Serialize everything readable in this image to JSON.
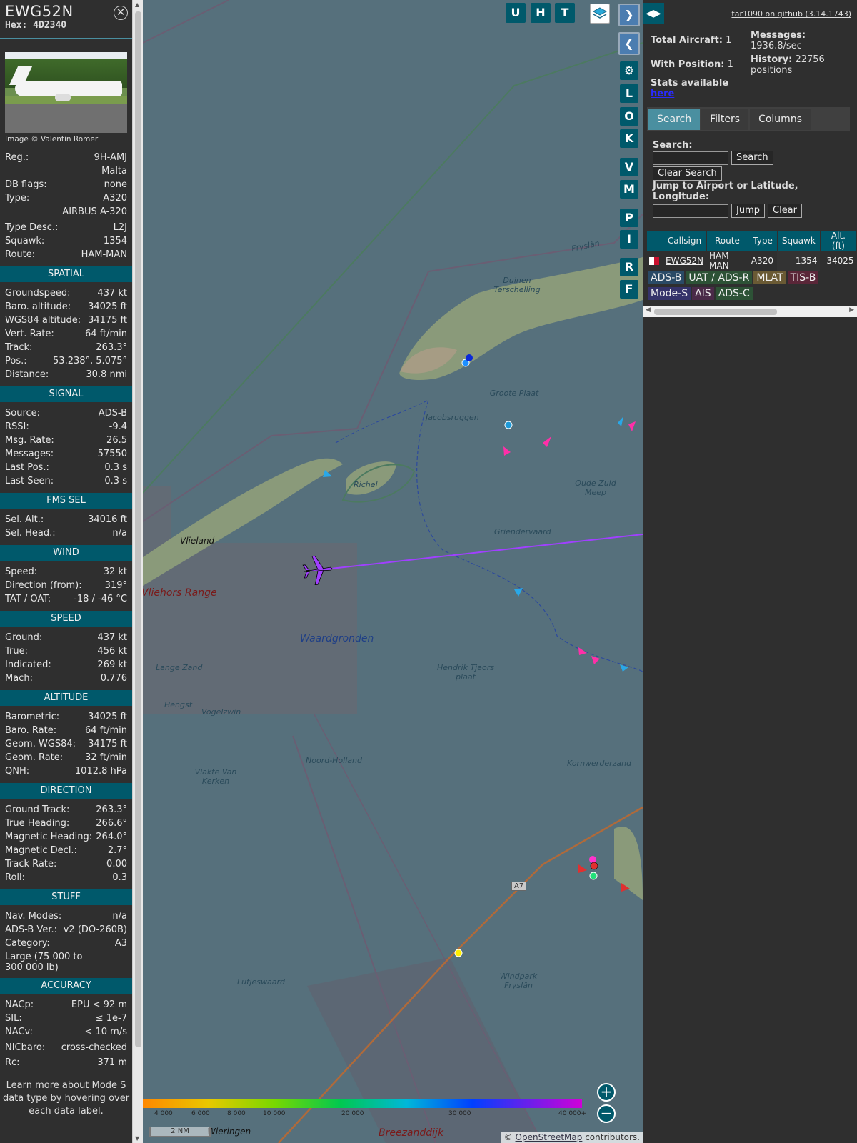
{
  "detail": {
    "callsign": "EWG52N",
    "hex_label": "Hex:",
    "hex": "4D2340",
    "photo_credit": "Image © Valentin Römer",
    "basic": [
      {
        "k": "Reg.:",
        "v": "9H-AMJ",
        "link": true
      },
      {
        "k": "",
        "v": "Malta"
      },
      {
        "k": "DB flags:",
        "v": "none"
      },
      {
        "k": "Type:",
        "v": "A320"
      },
      {
        "k": "",
        "v": "AIRBUS A-320"
      },
      {
        "k": "Type Desc.:",
        "v": "L2J"
      },
      {
        "k": "Squawk:",
        "v": "1354"
      },
      {
        "k": "Route:",
        "v": "HAM-MAN"
      }
    ],
    "sections": [
      {
        "title": "SPATIAL",
        "rows": [
          {
            "k": "Groundspeed:",
            "v": "437 kt"
          },
          {
            "k": "Baro. altitude:",
            "v": "34025 ft"
          },
          {
            "k": "WGS84 altitude:",
            "v": "34175 ft"
          },
          {
            "k": "Vert. Rate:",
            "v": "64 ft/min"
          },
          {
            "k": "Track:",
            "v": "263.3°"
          },
          {
            "k": "Pos.:",
            "v": "53.238°, 5.075°"
          },
          {
            "k": "Distance:",
            "v": "30.8 nmi"
          }
        ]
      },
      {
        "title": "SIGNAL",
        "rows": [
          {
            "k": "Source:",
            "v": "ADS-B"
          },
          {
            "k": "RSSI:",
            "v": "-9.4"
          },
          {
            "k": "Msg. Rate:",
            "v": "26.5"
          },
          {
            "k": "Messages:",
            "v": "57550"
          },
          {
            "k": "Last Pos.:",
            "v": "0.3 s"
          },
          {
            "k": "Last Seen:",
            "v": "0.3 s"
          }
        ]
      },
      {
        "title": "FMS SEL",
        "rows": [
          {
            "k": "Sel. Alt.:",
            "v": "34016 ft"
          },
          {
            "k": "Sel. Head.:",
            "v": "n/a"
          }
        ]
      },
      {
        "title": "WIND",
        "rows": [
          {
            "k": "Speed:",
            "v": "32 kt"
          },
          {
            "k": "Direction (from):",
            "v": "319°"
          },
          {
            "k": "TAT / OAT:",
            "v": "-18 / -46 °C"
          }
        ]
      },
      {
        "title": "SPEED",
        "rows": [
          {
            "k": "Ground:",
            "v": "437 kt"
          },
          {
            "k": "True:",
            "v": "456 kt"
          },
          {
            "k": "Indicated:",
            "v": "269 kt"
          },
          {
            "k": "Mach:",
            "v": "0.776"
          }
        ]
      },
      {
        "title": "ALTITUDE",
        "rows": [
          {
            "k": "Barometric:",
            "v": "34025 ft"
          },
          {
            "k": "Baro. Rate:",
            "v": "64 ft/min"
          },
          {
            "k": "Geom. WGS84:",
            "v": "34175 ft"
          },
          {
            "k": "Geom. Rate:",
            "v": "32 ft/min"
          },
          {
            "k": "QNH:",
            "v": "1012.8 hPa"
          }
        ]
      },
      {
        "title": "DIRECTION",
        "rows": [
          {
            "k": "Ground Track:",
            "v": "263.3°"
          },
          {
            "k": "True Heading:",
            "v": "266.6°"
          },
          {
            "k": "Magnetic Heading:",
            "v": "264.0°"
          },
          {
            "k": "Magnetic Decl.:",
            "v": "2.7°"
          },
          {
            "k": "Track Rate:",
            "v": "0.00"
          },
          {
            "k": "Roll:",
            "v": "0.3"
          }
        ]
      },
      {
        "title": "STUFF",
        "rows": [
          {
            "k": "Nav. Modes:",
            "v": "n/a"
          },
          {
            "k": "ADS-B Ver.:",
            "v": "v2 (DO-260B)"
          },
          {
            "k": "Category:",
            "v": "A3"
          }
        ]
      },
      {
        "title": "ACCURACY",
        "rows": [
          {
            "k": "NACp:",
            "v": "EPU < 92 m"
          },
          {
            "k": "SIL:",
            "v": "≤ 1e-7"
          },
          {
            "k": "NACv:",
            "v": "< 10 m/s"
          },
          {
            "k": "NICbaro:",
            "v": "cross-checked"
          },
          {
            "k": "Rc:",
            "v": "371 m"
          }
        ]
      }
    ],
    "category_desc": "Large (75 000 to 300 000 lb)",
    "learn_more": "Learn more about Mode S data type by hovering over each data label."
  },
  "map": {
    "layer_buttons": [
      "U",
      "H",
      "T"
    ],
    "side_buttons": [
      "L",
      "O",
      "K",
      "V",
      "M",
      "P",
      "I",
      "R",
      "F"
    ],
    "labels": [
      {
        "text": "Duinen Terschelling"
      },
      {
        "text": "Groote Plaat"
      },
      {
        "text": "Jacobsruggen"
      },
      {
        "text": "Richel"
      },
      {
        "text": "Oude Zuid Meep"
      },
      {
        "text": "Griendervaard"
      },
      {
        "text": "Vlieland"
      },
      {
        "text": "Vliehors Range"
      },
      {
        "text": "Waardgronden"
      },
      {
        "text": "Hendrik Tjaors plaat"
      },
      {
        "text": "Lange Zand"
      },
      {
        "text": "Hengst"
      },
      {
        "text": "Vogelzwin"
      },
      {
        "text": "Noord-Holland"
      },
      {
        "text": "Fryslân"
      },
      {
        "text": "Vlakte Van Kerken"
      },
      {
        "text": "Kornwerderzand"
      },
      {
        "text": "A7"
      },
      {
        "text": "Windpark Fryslân"
      },
      {
        "text": "Lutjeswaard"
      },
      {
        "text": "Wieringen"
      },
      {
        "text": "Breezanddijk"
      }
    ],
    "color_scale_labels": [
      "4 000",
      "6 000",
      "8 000",
      "10 000",
      "20 000",
      "30 000",
      "40 000+"
    ],
    "scale_bar": "2 NM",
    "attribution_prefix": "©",
    "attribution_link": "OpenStreetMap",
    "attribution_suffix": "contributors."
  },
  "right": {
    "github_link": "tar1090 on github (3.14.1743)",
    "stats": {
      "total_aircraft_label": "Total Aircraft:",
      "total_aircraft": "1",
      "with_position_label": "With Position:",
      "with_position": "1",
      "messages_label": "Messages:",
      "messages": "1936.8/sec",
      "history_label": "History:",
      "history": "22756 positions",
      "stats_label": "Stats available",
      "stats_link": "here"
    },
    "tabs": [
      "Search",
      "Filters",
      "Columns"
    ],
    "search": {
      "label": "Search:",
      "search_button": "Search",
      "clear_search_button": "Clear Search",
      "jump_label": "Jump to Airport or Latitude, Longitude:",
      "jump_button": "Jump",
      "clear_button": "Clear"
    },
    "table": {
      "headers": [
        "",
        "Callsign",
        "Route",
        "Type",
        "Squawk",
        "Alt. (ft)"
      ],
      "rows": [
        {
          "callsign": "EWG52N",
          "route": "HAM-MAN",
          "type": "A320",
          "squawk": "1354",
          "alt": "34025"
        }
      ]
    },
    "source_tags": [
      {
        "label": "ADS-B",
        "color": "#2a4a66"
      },
      {
        "label": "UAT / ADS-R",
        "color": "#2d5236"
      },
      {
        "label": "MLAT",
        "color": "#6a5a34"
      },
      {
        "label": "TIS-B",
        "color": "#5a2638"
      },
      {
        "label": "Mode-S",
        "color": "#35336a"
      },
      {
        "label": "AIS",
        "color": "#4a2a48"
      },
      {
        "label": "ADS-C",
        "color": "#2d5236"
      }
    ]
  },
  "colors": {
    "accent": "#00596b",
    "track": "#a040ff"
  }
}
